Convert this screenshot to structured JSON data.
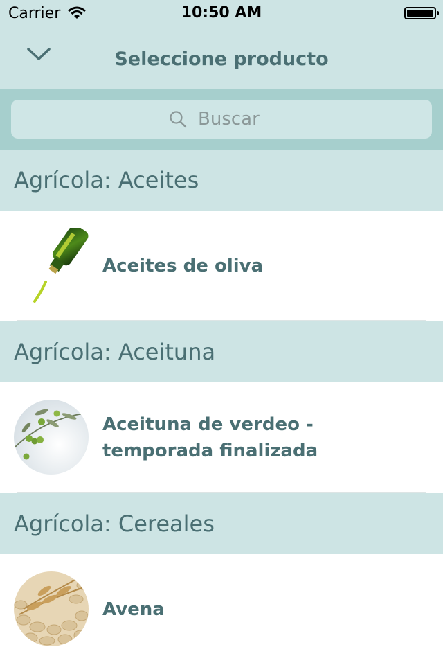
{
  "status_bar": {
    "carrier": "Carrier",
    "time": "10:50 AM",
    "battery": "full"
  },
  "nav": {
    "title": "Seleccione producto",
    "back_icon": "chevron-down-icon"
  },
  "search": {
    "placeholder": "Buscar",
    "icon": "search-icon"
  },
  "sections": [
    {
      "header": "Agrícola: Aceites",
      "items": [
        {
          "label": "Aceites de oliva",
          "image": "olive-oil-bottle"
        }
      ]
    },
    {
      "header": "Agrícola: Aceituna",
      "items": [
        {
          "label": "Aceituna de verdeo - temporada finalizada",
          "image": "olive-branch"
        }
      ]
    },
    {
      "header": "Agrícola: Cereales",
      "items": [
        {
          "label": "Avena",
          "image": "oat-grains"
        }
      ]
    }
  ],
  "colors": {
    "nav_background": "#cde4e4",
    "search_band": "#a6cfcd",
    "accent_text": "#4a6f73"
  }
}
